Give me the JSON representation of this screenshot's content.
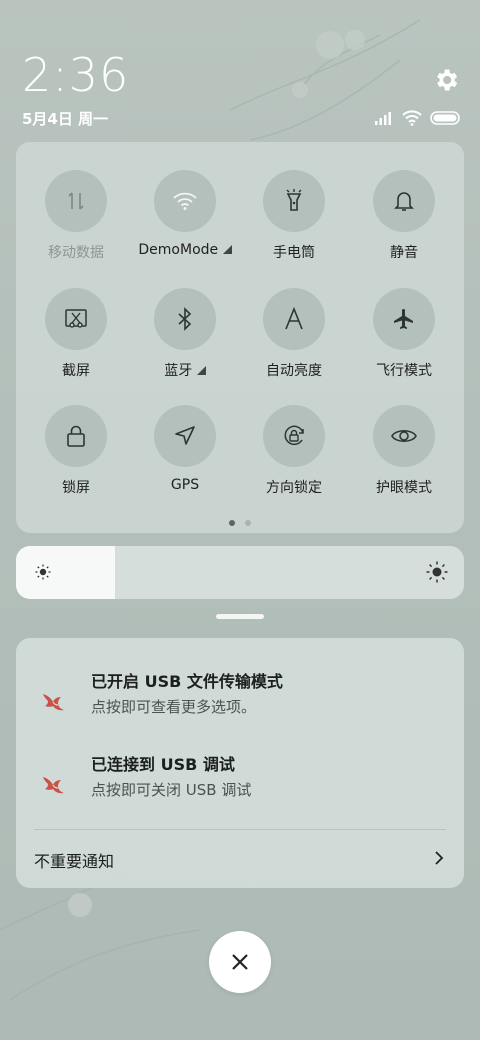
{
  "status_bar": {
    "time": "2:36",
    "date": "5月4日 周一",
    "icons": [
      "signal-icon",
      "wifi-icon",
      "battery-icon"
    ]
  },
  "quick_settings": {
    "tiles": [
      {
        "label": "移动数据",
        "icon": "mobile-data-icon",
        "enabled": false
      },
      {
        "label": "DemoMode",
        "icon": "wifi-icon",
        "enabled": true,
        "has_submenu": true
      },
      {
        "label": "手电筒",
        "icon": "flashlight-icon",
        "enabled": true
      },
      {
        "label": "静音",
        "icon": "bell-icon",
        "enabled": true
      },
      {
        "label": "截屏",
        "icon": "screenshot-icon",
        "enabled": true
      },
      {
        "label": "蓝牙",
        "icon": "bluetooth-icon",
        "enabled": true,
        "has_submenu": true
      },
      {
        "label": "自动亮度",
        "icon": "auto-brightness-icon",
        "enabled": true
      },
      {
        "label": "飞行模式",
        "icon": "airplane-icon",
        "enabled": true
      },
      {
        "label": "锁屏",
        "icon": "lock-icon",
        "enabled": true
      },
      {
        "label": "GPS",
        "icon": "location-arrow-icon",
        "enabled": true
      },
      {
        "label": "方向锁定",
        "icon": "rotation-lock-icon",
        "enabled": true
      },
      {
        "label": "护眼模式",
        "icon": "eye-icon",
        "enabled": true
      }
    ],
    "page_count": 2,
    "active_page": 1
  },
  "brightness": {
    "level": 0.22,
    "low_icon": "sun-small-icon",
    "high_icon": "sun-large-icon"
  },
  "notifications": [
    {
      "title": "已开启 USB 文件传输模式",
      "body": "点按即可查看更多选项。",
      "icon": "swallow-icon"
    },
    {
      "title": "已连接到 USB 调试",
      "body": "点按即可关闭 USB 调试",
      "icon": "swallow-icon"
    }
  ],
  "unimportant_label": "不重要通知",
  "colors": {
    "background": "#b5c0bb",
    "panel": "#d0dad6",
    "tile": "#a3b0ab",
    "swallow": "#c9534a"
  }
}
